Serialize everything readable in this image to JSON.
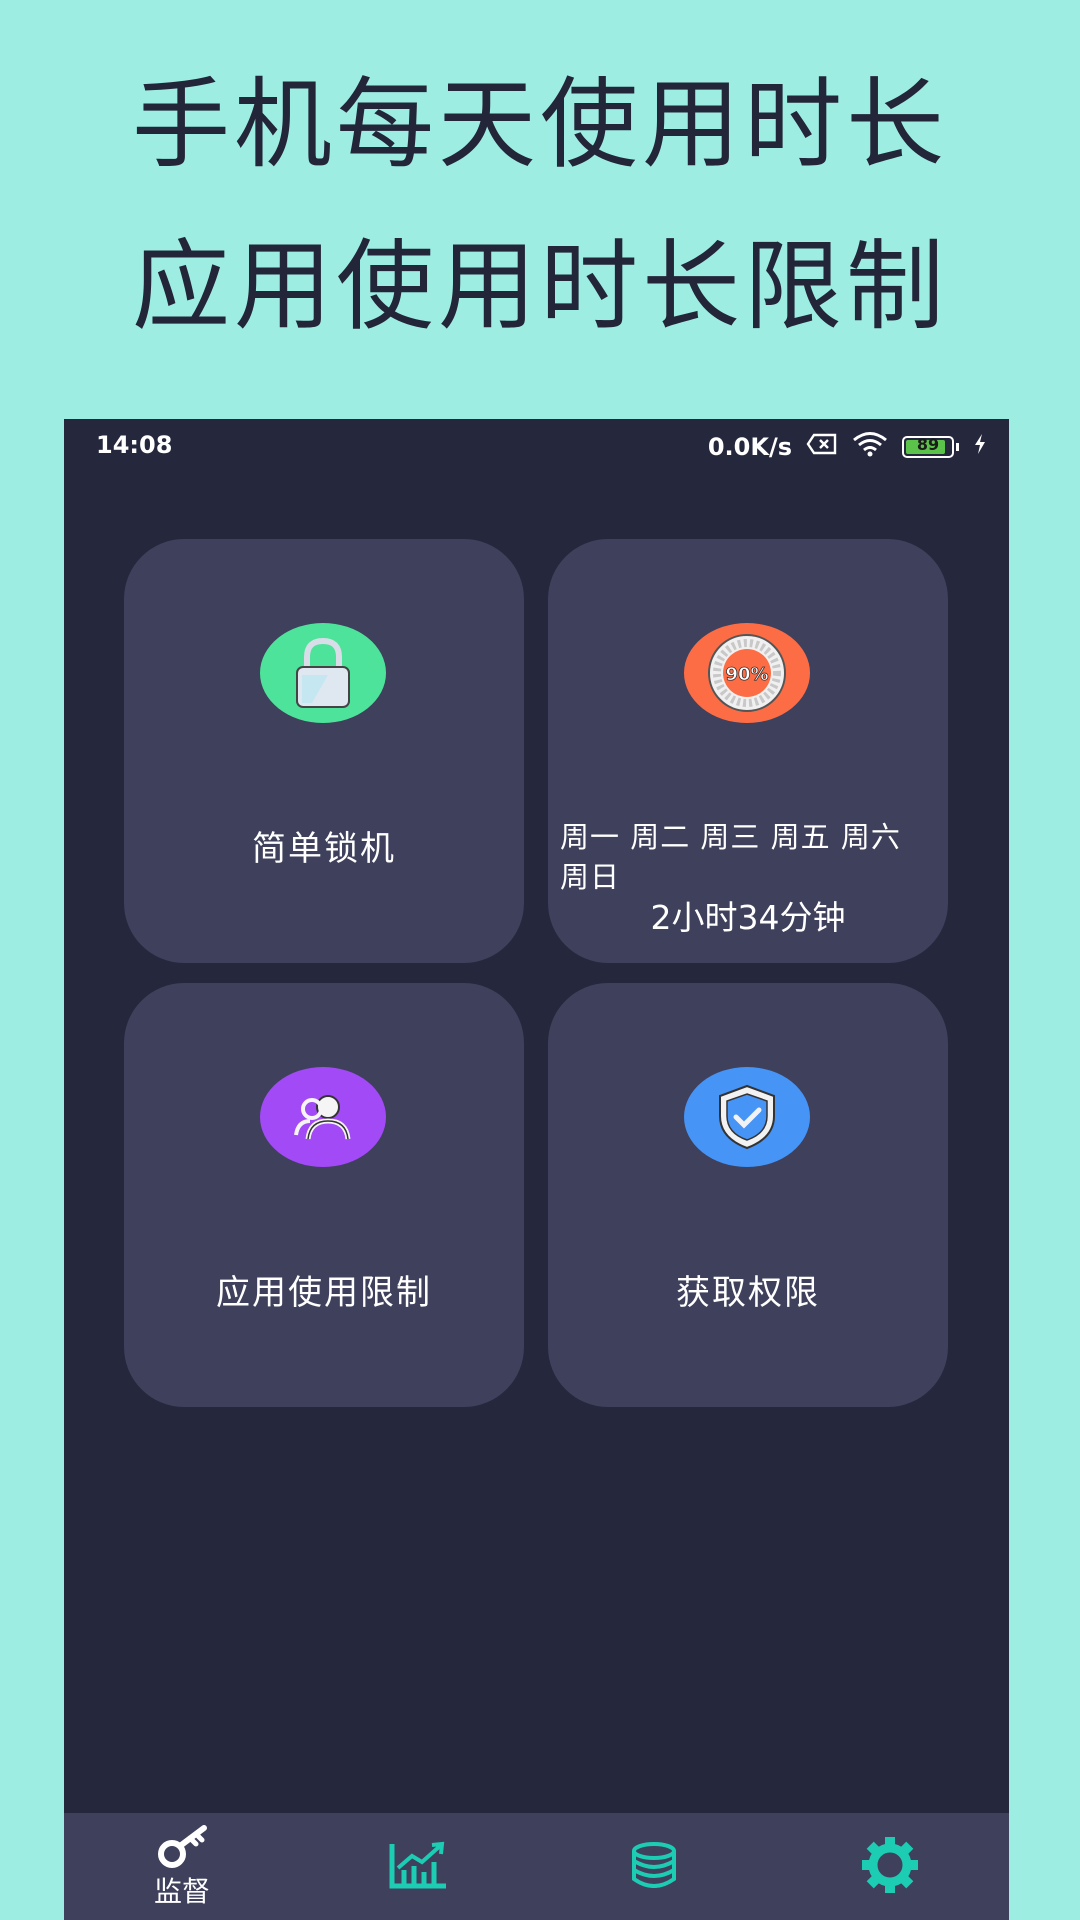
{
  "promo": {
    "line1": "手机每天使用时长",
    "line2": "应用使用时长限制"
  },
  "statusbar": {
    "time": "14:08",
    "net_speed": "0.0K/s",
    "battery": "89",
    "battery_level": 0.89,
    "icons": [
      "sim-x-icon",
      "wifi-icon",
      "battery-icon",
      "charging-bolt-icon"
    ]
  },
  "cards": {
    "lock": {
      "label": "简单锁机",
      "icon": "padlock-icon",
      "color": "#4ee39a"
    },
    "usage": {
      "weekdays": "周一 周二 周三 周五 周六 周日",
      "duration": "2小时34分钟",
      "badge": "90%",
      "icon": "percent-ring-icon",
      "color": "#fd6d45"
    },
    "app_limit": {
      "label": "应用使用限制",
      "icon": "users-icon",
      "color": "#a24af5"
    },
    "permission": {
      "label": "获取权限",
      "icon": "shield-check-icon",
      "color": "#4594f6"
    }
  },
  "bottomnav": {
    "items": [
      {
        "label": "监督",
        "icon": "key-icon",
        "active": true
      },
      {
        "icon": "chart-icon"
      },
      {
        "icon": "database-icon"
      },
      {
        "icon": "gear-icon"
      }
    ],
    "accent": "#1ccdb4"
  }
}
